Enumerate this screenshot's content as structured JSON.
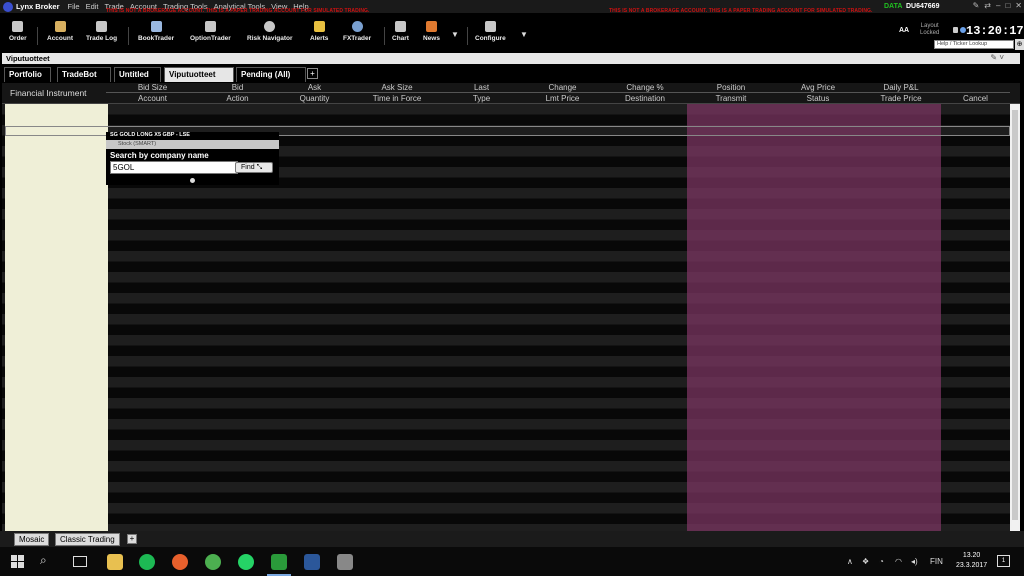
{
  "app": {
    "title": "Lynx Broker",
    "menu": [
      "File",
      "Edit",
      "Trade",
      "Account",
      "Trading Tools",
      "Analytical Tools",
      "View",
      "Help"
    ],
    "paper_warning": "THIS IS NOT A BROKERAGE ACCOUNT. THIS IS A PAPER TRADING ACCOUNT FOR SIMULATED TRADING.",
    "data_label": "DATA",
    "account_id": "DU647669"
  },
  "toolbar": {
    "buttons": [
      {
        "label": "Order",
        "icon": "order-icon"
      },
      {
        "label": "Account",
        "icon": "account-icon"
      },
      {
        "label": "Trade Log",
        "icon": "trade-log-icon"
      },
      {
        "label": "BookTrader",
        "icon": "booktrader-icon"
      },
      {
        "label": "OptionTrader",
        "icon": "optiontrader-icon"
      },
      {
        "label": "Risk Navigator",
        "icon": "risk-navigator-icon"
      },
      {
        "label": "Alerts",
        "icon": "alerts-icon"
      },
      {
        "label": "FXTrader",
        "icon": "fxtrader-icon"
      },
      {
        "label": "Chart",
        "icon": "chart-icon"
      },
      {
        "label": "News",
        "icon": "news-icon"
      },
      {
        "label": "Configure",
        "icon": "configure-icon"
      }
    ],
    "font_size_label": "AA",
    "layout_label_1": "Layout",
    "layout_label_2": "Locked",
    "clock": "13:20:17",
    "ticker_placeholder": "Help / Ticker Lookup"
  },
  "window": {
    "title": "Viputuotteet"
  },
  "tabs": [
    {
      "label": "Portfolio",
      "active": false
    },
    {
      "label": "TradeBot",
      "active": false
    },
    {
      "label": "Untitled",
      "active": false
    },
    {
      "label": "Viputuotteet",
      "active": true
    },
    {
      "label": "Pending (All)",
      "active": false
    }
  ],
  "tab_add": "+",
  "columns": {
    "fixed": "Financial Instrument",
    "pairs": [
      {
        "top": "Bid Size",
        "bottom": "Account"
      },
      {
        "top": "Bid",
        "bottom": "Action"
      },
      {
        "top": "Ask",
        "bottom": "Quantity"
      },
      {
        "top": "Ask Size",
        "bottom": "Time in Force"
      },
      {
        "top": "Last",
        "bottom": "Type"
      },
      {
        "top": "Change",
        "bottom": "Lmt Price"
      },
      {
        "top": "Change %",
        "bottom": "Destination"
      },
      {
        "top": "Position",
        "bottom": "Transmit"
      },
      {
        "top": "Avg Price",
        "bottom": "Status"
      },
      {
        "top": "Daily P&L",
        "bottom": "Trade Price"
      },
      {
        "top": "",
        "bottom": "Cancel"
      }
    ]
  },
  "search_popup": {
    "instrument": "SG GOLD LONG X5 GBP - LSE",
    "type": "Stock (SMART)",
    "label": "Search by company name",
    "input_value": "5GOL",
    "find_label": "Find"
  },
  "mosaic_tabs": [
    "Mosaic",
    "Classic Trading"
  ],
  "mosaic_add": "+",
  "taskbar": {
    "language": "FIN",
    "time": "13.20",
    "date": "23.3.2017",
    "notifications": "1",
    "apps": [
      "file-explorer-icon",
      "spotify-icon",
      "firefox-icon",
      "chrome-icon",
      "whatsapp-icon",
      "lynx-icon",
      "word-icon",
      "photos-icon"
    ]
  },
  "colors": {
    "fi_column": "#efefd7",
    "order_columns": "#7e3664",
    "data_green": "#20c020",
    "warning_red": "#d01010"
  }
}
